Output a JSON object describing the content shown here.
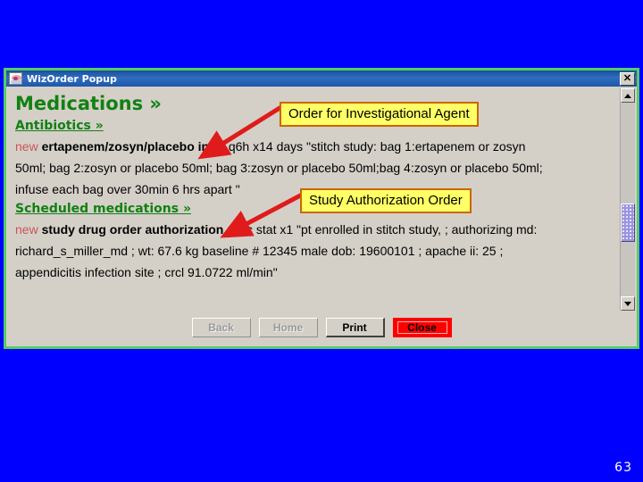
{
  "window": {
    "title": "WizOrder Popup",
    "close_label": "✕",
    "icon": "app-icon"
  },
  "content": {
    "heading_main": "Medications »",
    "heading_sub": "Antibiotics »",
    "heading_sub2": "Scheduled medications »",
    "order1": {
      "status": "new",
      "drug": "ertapenem/zosyn/placebo inj",
      "detail_line1": "iv q6h x14 days \"stitch study: bag 1:ertapenem or zosyn",
      "detail_line2": "50ml; bag 2:zosyn or placebo 50ml; bag 3:zosyn or placebo 50ml;bag 4:zosyn or placebo 50ml;",
      "detail_line3": "infuse each bag over 30min 6 hrs apart \""
    },
    "order2": {
      "status": "new",
      "drug": "study drug order authorization",
      "detail_line1": "misc stat x1 \"pt enrolled in stitch study, ; authorizing md:",
      "detail_line2": "richard_s_miller_md ; wt: 67.6 kg baseline # 12345 male dob: 19600101 ; apache ii: 25 ;",
      "detail_line3": "appendicitis infection site ; crcl 91.0722 ml/min\""
    }
  },
  "callouts": [
    {
      "label": "Order for Investigational Agent"
    },
    {
      "label": "Study Authorization Order"
    }
  ],
  "buttons": [
    {
      "label": "Back",
      "state": "disabled"
    },
    {
      "label": "Home",
      "state": "disabled"
    },
    {
      "label": "Print",
      "state": "enabled"
    },
    {
      "label": "Close",
      "state": "focused"
    }
  ],
  "scrollbar": {
    "up_arrow": "▲",
    "down_arrow": "▼"
  },
  "slide": {
    "page_number": "63"
  },
  "colors": {
    "background": "#0000ff",
    "window_border": "#55cc66",
    "titlebar": "#1f57a8",
    "heading_green": "#128013",
    "callout_fill": "#ffff66",
    "callout_border": "#cc6600",
    "arrow_red": "#e01b1b",
    "close_red": "#ff0000",
    "scroll_thumb": "#9a94e0"
  }
}
